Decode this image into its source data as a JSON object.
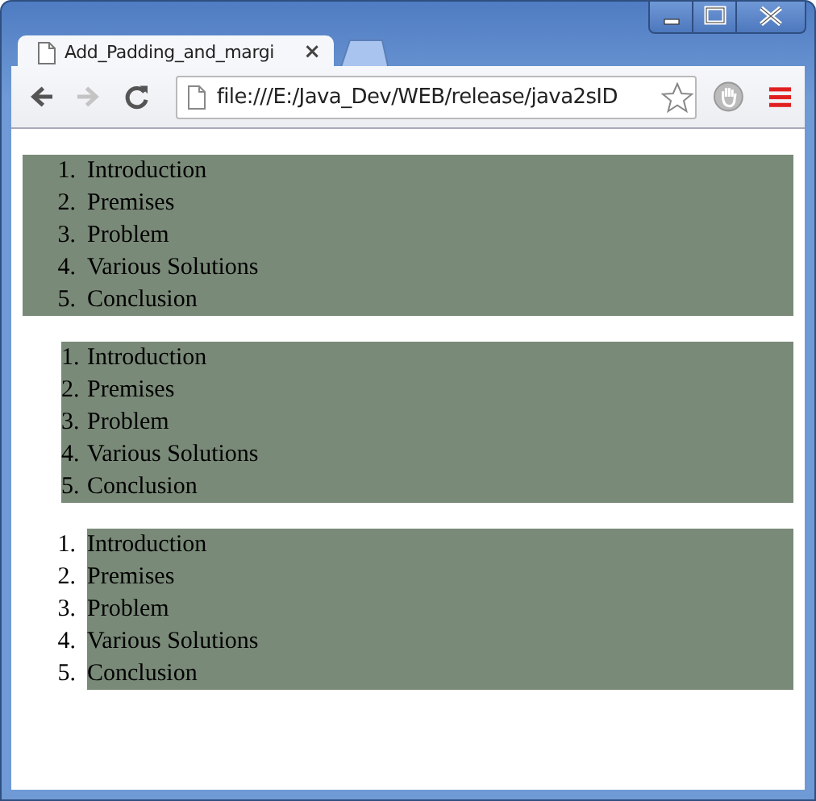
{
  "window": {
    "controls": [
      {
        "kind": "minimize"
      },
      {
        "kind": "maximize"
      },
      {
        "kind": "close"
      }
    ]
  },
  "tabs": [
    {
      "title": "Add_Padding_and_margi",
      "close": "×",
      "selected": true
    },
    {
      "selected": false,
      "kind": "new"
    }
  ],
  "toolbar": {
    "buttons": [
      {
        "kind": "back",
        "disabled": false
      },
      {
        "kind": "forward",
        "disabled": true
      },
      {
        "kind": "reload",
        "disabled": false
      }
    ],
    "address": "file:///E:/Java_Dev/WEB/release/java2sID"
  },
  "lists": [
    {
      "kind": "padded",
      "items": [
        {
          "number": "1.",
          "text": "Introduction"
        },
        {
          "number": "2.",
          "text": "Premises"
        },
        {
          "number": "3.",
          "text": "Problem"
        },
        {
          "number": "4.",
          "text": "Various Solutions"
        },
        {
          "number": "5.",
          "text": "Conclusion"
        }
      ]
    },
    {
      "kind": "margin",
      "items": [
        {
          "number": "1.",
          "text": "Introduction"
        },
        {
          "number": "2.",
          "text": "Premises"
        },
        {
          "number": "3.",
          "text": "Problem"
        },
        {
          "number": "4.",
          "text": "Various Solutions"
        },
        {
          "number": "5.",
          "text": "Conclusion"
        }
      ]
    },
    {
      "kind": "outside",
      "items": [
        {
          "number": "1.",
          "text": "Introduction"
        },
        {
          "number": "2.",
          "text": "Premises"
        },
        {
          "number": "3.",
          "text": "Problem"
        },
        {
          "number": "4.",
          "text": "Various Solutions"
        },
        {
          "number": "5.",
          "text": "Conclusion"
        }
      ]
    }
  ]
}
